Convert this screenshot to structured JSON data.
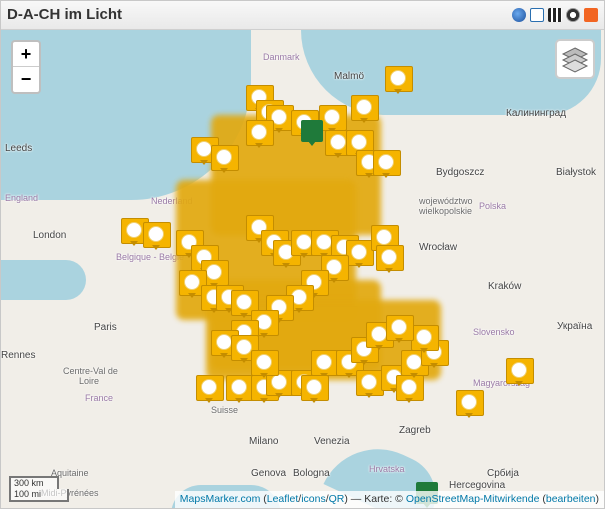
{
  "window": {
    "title": "D-A-CH im Licht"
  },
  "toolbar": {
    "icons": [
      "globe-icon",
      "fullscreen-icon",
      "qr-code-icon",
      "kml-icon",
      "rss-icon"
    ]
  },
  "map": {
    "zoom_in_label": "+",
    "zoom_out_label": "−",
    "layers_icon": "layers-icon",
    "scale": {
      "metric": "300 km",
      "imperial": "100 mi"
    },
    "attribution": {
      "mapsmarker": "MapsMarker.com",
      "open_paren": " (",
      "leaflet": "Leaflet",
      "slash1": "/",
      "icons": "icons",
      "slash2": "/",
      "qr": "QR",
      "middle": ") — Karte: © ",
      "osm": "OpenStreetMap-Mitwirkende",
      "edit_open": " (",
      "edit": "bearbeiten",
      "edit_close": ")"
    },
    "places": [
      {
        "name": "Danmark",
        "cls": "country"
      },
      {
        "name": "Malmö",
        "cls": ""
      },
      {
        "name": "Калининград",
        "cls": ""
      },
      {
        "name": "Leeds",
        "cls": ""
      },
      {
        "name": "England",
        "cls": "country"
      },
      {
        "name": "Bydgoszcz",
        "cls": ""
      },
      {
        "name": "Białystok",
        "cls": ""
      },
      {
        "name": "London",
        "cls": ""
      },
      {
        "name": "województwo",
        "cls": "small"
      },
      {
        "name": "wielkopolskie",
        "cls": "small"
      },
      {
        "name": "Polska",
        "cls": "country"
      },
      {
        "name": "Wrocław",
        "cls": ""
      },
      {
        "name": "Kraków",
        "cls": ""
      },
      {
        "name": "Paris",
        "cls": ""
      },
      {
        "name": "Rennes",
        "cls": ""
      },
      {
        "name": "Centre-Val de",
        "cls": "small"
      },
      {
        "name": "Loire",
        "cls": "small"
      },
      {
        "name": "France",
        "cls": "country"
      },
      {
        "name": "Slovensko",
        "cls": "country"
      },
      {
        "name": "Україна",
        "cls": ""
      },
      {
        "name": "Magyarország",
        "cls": "country"
      },
      {
        "name": "Zagreb",
        "cls": ""
      },
      {
        "name": "Milano",
        "cls": ""
      },
      {
        "name": "Venezia",
        "cls": ""
      },
      {
        "name": "Genova",
        "cls": ""
      },
      {
        "name": "Bologna",
        "cls": ""
      },
      {
        "name": "Hrvatska",
        "cls": "country"
      },
      {
        "name": "Србија",
        "cls": ""
      },
      {
        "name": "Hercegovina",
        "cls": ""
      },
      {
        "name": "Belgique - België",
        "cls": "country"
      },
      {
        "name": "Nederland",
        "cls": "country"
      },
      {
        "name": "Aquitaine",
        "cls": "small"
      },
      {
        "name": "Midi-Pyrénées",
        "cls": "small"
      },
      {
        "name": "Suisse",
        "cls": "small"
      }
    ],
    "markers": {
      "icon": "smiley-marker-icon",
      "count": 60
    },
    "colors": {
      "marker": "#f5b400",
      "sea": "#aad3df",
      "land": "#f1eee8",
      "green": "#1f7a3a"
    }
  }
}
